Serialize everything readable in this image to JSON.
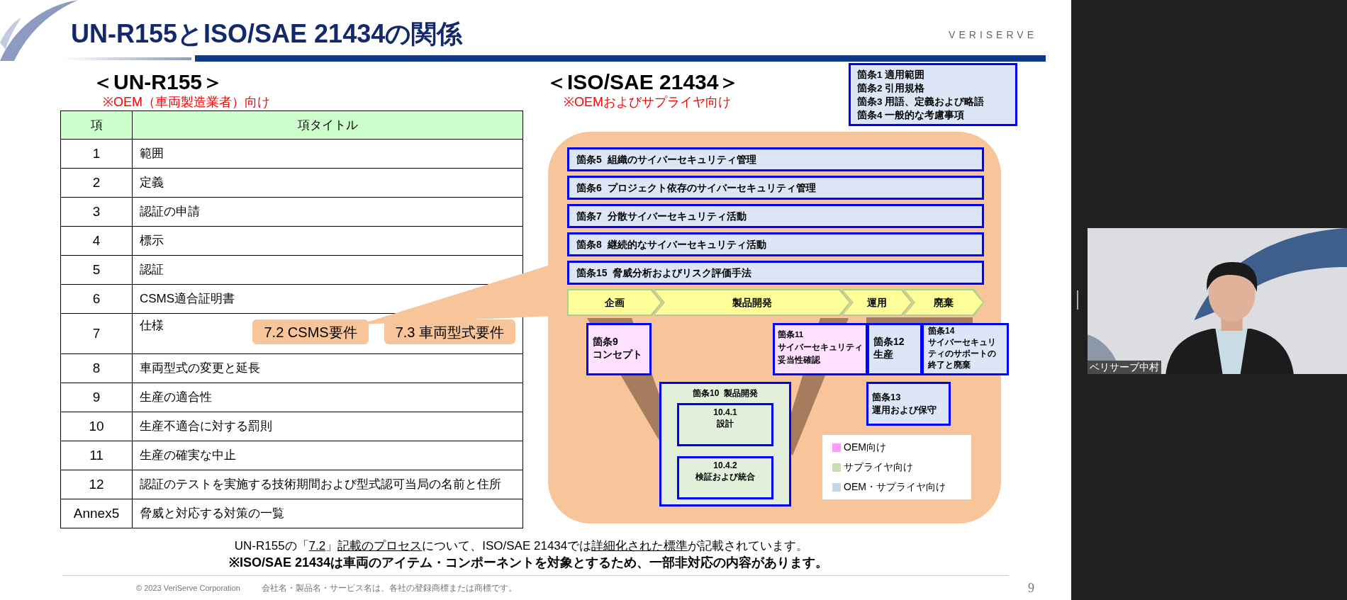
{
  "slide": {
    "title": "UN-R155とISO/SAE 21434の関係",
    "logo": "VERISERVE",
    "left": {
      "heading": "＜UN-R155＞",
      "note": "※OEM（車両製造業者）向け",
      "table": {
        "columns": [
          "項",
          "項タイトル"
        ],
        "rows": [
          {
            "number": "1",
            "title": "範囲"
          },
          {
            "number": "2",
            "title": "定義"
          },
          {
            "number": "3",
            "title": "認証の申請"
          },
          {
            "number": "4",
            "title": "標示"
          },
          {
            "number": "5",
            "title": "認証"
          },
          {
            "number": "6",
            "title": "CSMS適合証明書"
          },
          {
            "number": "7",
            "title": "仕様",
            "badges": [
              "7.2 CSMS要件",
              "7.3 車両型式要件"
            ]
          },
          {
            "number": "8",
            "title": "車両型式の変更と延長"
          },
          {
            "number": "9",
            "title": "生産の適合性"
          },
          {
            "number": "10",
            "title": "生産不適合に対する罰則"
          },
          {
            "number": "11",
            "title": "生産の確実な中止"
          },
          {
            "number": "12",
            "title": "認証のテストを実施する技術期間および型式認可当局の名前と住所"
          },
          {
            "number": "Annex5",
            "title": "脅威と対応する対策の一覧"
          }
        ]
      }
    },
    "right": {
      "heading": "＜ISO/SAE 21434＞",
      "note": "※OEMおよびサプライヤ向け",
      "general_clauses": [
        "箇条1 適用範囲",
        "箇条2 引用規格",
        "箇条3 用語、定義および略語",
        "箇条4 一般的な考慮事項"
      ],
      "clause_bars": [
        {
          "label": "箇条5",
          "title": "組織のサイバーセキュリティ管理"
        },
        {
          "label": "箇条6",
          "title": "プロジェクト依存のサイバーセキュリティ管理"
        },
        {
          "label": "箇条7",
          "title": "分散サイバーセキュリティ活動"
        },
        {
          "label": "箇条8",
          "title": "継続的なサイバーセキュリティ活動"
        },
        {
          "label": "箇条15",
          "title": "脅威分析およびリスク評価手法"
        }
      ],
      "phases": [
        {
          "label": "企画"
        },
        {
          "label": "製品開発"
        },
        {
          "label": "運用"
        },
        {
          "label": "廃棄"
        }
      ],
      "phase_clauses": [
        {
          "lines": [
            "箇条9",
            "コンセプト"
          ],
          "kind": "oem"
        },
        {
          "lines": [
            "箇条11",
            "サイバーセキュリティ",
            "妥当性確認"
          ],
          "kind": "oem"
        },
        {
          "lines": [
            "箇条12",
            "生産"
          ],
          "kind": "both"
        },
        {
          "lines": [
            "箇条14",
            "サイバーセキュリ",
            "ティのサポートの",
            "終了と廃棄"
          ],
          "kind": "both"
        },
        {
          "lines": [
            "箇条13",
            "運用および保守"
          ],
          "kind": "both"
        }
      ],
      "product_development": {
        "title": "箇条10  製品開発",
        "kind": "supplier",
        "items": [
          {
            "number": "10.4.1",
            "title": "設計"
          },
          {
            "number": "10.4.2",
            "title": "検証および統合"
          }
        ]
      },
      "legend": [
        {
          "label": "OEM向け",
          "color": "#ff99ff"
        },
        {
          "label": "サプライヤ向け",
          "color": "#c6e0b4"
        },
        {
          "label": "OEM・サプライヤ向け",
          "color": "#c5d5ee"
        }
      ]
    },
    "summary": {
      "segments": [
        {
          "text": "UN-R155の「",
          "underline": false
        },
        {
          "text": "7.2",
          "underline": true
        },
        {
          "text": "」",
          "underline": false
        },
        {
          "text": "記載のプロセス",
          "underline": true
        },
        {
          "text": "について、ISO/SAE 21434では",
          "underline": false
        },
        {
          "text": "詳細化された標準",
          "underline": true
        },
        {
          "text": "が記載されています。",
          "underline": false
        }
      ]
    },
    "caution": "※ISO/SAE 21434は車両のアイテム・コンポーネントを対象とするため、一部非対応の内容があります。",
    "footer": {
      "copyright": "© 2023 VeriServe Corporation",
      "trademark": "会社名・製品名・サービス名は、各社の登録商標または商標です。",
      "page": "9"
    }
  },
  "video": {
    "name": "ベリサーブ中村"
  }
}
